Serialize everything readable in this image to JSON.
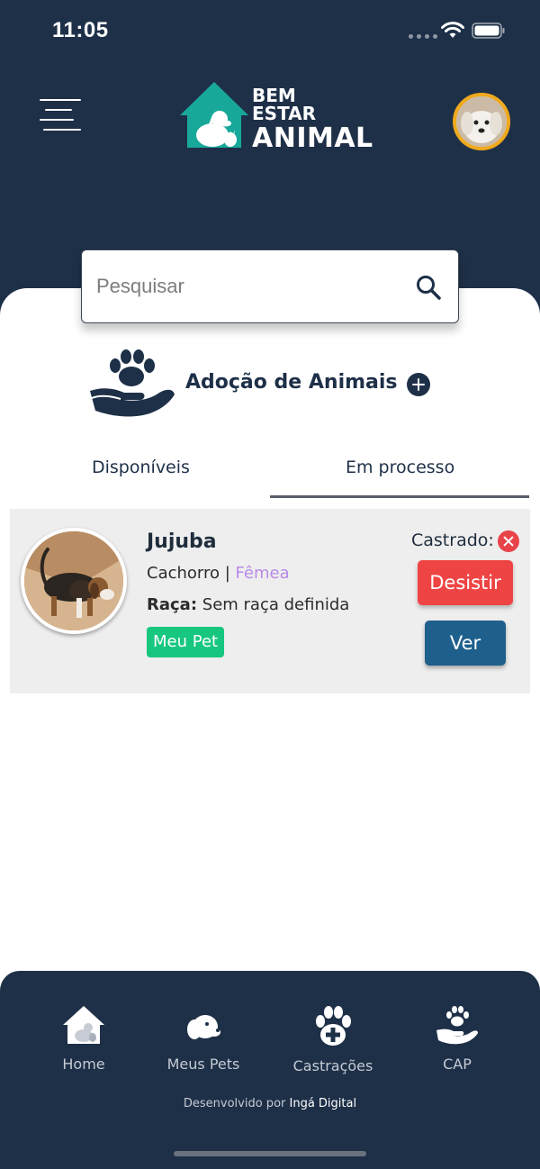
{
  "status_bar": {
    "time": "11:05"
  },
  "header": {
    "logo_line1": "BEM",
    "logo_line2": "ESTAR",
    "logo_line3": "ANIMAL"
  },
  "search": {
    "placeholder": "Pesquisar"
  },
  "section": {
    "title": "Adoção de Animais"
  },
  "tabs": [
    {
      "label": "Disponíveis",
      "active": false
    },
    {
      "label": "Em processo",
      "active": true
    }
  ],
  "pet_card": {
    "name": "Jujuba",
    "species": "Cachorro",
    "separator": " | ",
    "sex": "Fêmea",
    "breed_label": "Raça:",
    "breed_value": "Sem raça definida",
    "badge": "Meu Pet",
    "castrado_label": "Castrado:",
    "castrado": false,
    "desistir_label": "Desistir",
    "ver_label": "Ver"
  },
  "bottom_nav": {
    "items": [
      {
        "label": "Home",
        "icon": "home-pets-icon"
      },
      {
        "label": "Meus Pets",
        "icon": "dog-head-icon"
      },
      {
        "label": "Castrações",
        "icon": "paw-plus-icon"
      },
      {
        "label": "CAP",
        "icon": "hand-paw-icon"
      }
    ],
    "credit_prefix": "Desenvolvido por ",
    "credit_company": "Ingá Digital"
  },
  "colors": {
    "header_bg": "#1e3048",
    "accent_teal": "#17a89a",
    "badge_green": "#17c77f",
    "danger": "#ef4444",
    "primary_button": "#1e5f8c",
    "sex_purple": "#b98ae8",
    "avatar_ring": "#f0a91c"
  }
}
